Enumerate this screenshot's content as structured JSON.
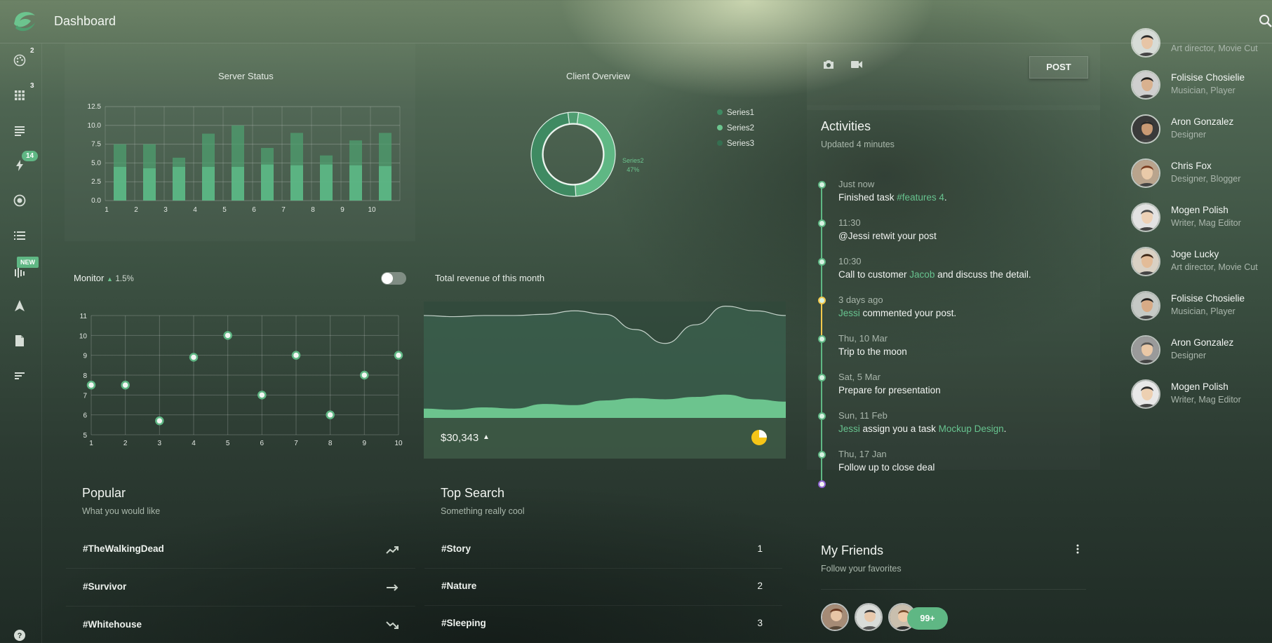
{
  "app": {
    "title": "Dashboard"
  },
  "sidebar": {
    "items": [
      {
        "icon": "palette-icon",
        "badge": "2"
      },
      {
        "icon": "apps-icon",
        "badge": "3"
      },
      {
        "icon": "notes-icon",
        "badge": ""
      },
      {
        "icon": "flash-icon",
        "badge": "14"
      },
      {
        "icon": "record-icon",
        "badge": ""
      },
      {
        "icon": "list-icon",
        "badge": ""
      },
      {
        "icon": "waveform-icon",
        "badge": "NEW"
      },
      {
        "icon": "navigation-icon",
        "badge": ""
      },
      {
        "icon": "file-icon",
        "badge": ""
      },
      {
        "icon": "sort-icon",
        "badge": ""
      },
      {
        "icon": "help-icon",
        "badge": ""
      }
    ]
  },
  "server_status": {
    "title": "Server Status"
  },
  "client_overview": {
    "title": "Client Overview",
    "legend": [
      "Series1",
      "Series2",
      "Series3"
    ],
    "tooltip_series": "Series2",
    "tooltip_value": "47%"
  },
  "monitor": {
    "title": "Monitor",
    "change": "1.5%"
  },
  "revenue": {
    "title": "Total revenue of this month",
    "amount": "$30,343"
  },
  "popular": {
    "title": "Popular",
    "subtitle": "What you would like",
    "items": [
      {
        "label": "#TheWalkingDead",
        "trend": "trending-up-icon"
      },
      {
        "label": "#Survivor",
        "trend": "trending-flat-icon"
      },
      {
        "label": "#Whitehouse",
        "trend": "trending-down-icon"
      }
    ]
  },
  "top_search": {
    "title": "Top Search",
    "subtitle": "Something really cool",
    "items": [
      {
        "label": "#Story",
        "rank": "1"
      },
      {
        "label": "#Nature",
        "rank": "2"
      },
      {
        "label": "#Sleeping",
        "rank": "3"
      }
    ]
  },
  "composer": {
    "post_label": "POST"
  },
  "activities": {
    "title": "Activities",
    "subtitle": "Updated 4 minutes",
    "items": [
      {
        "time": "Just now",
        "pre": "Finished task ",
        "link": "#features 4",
        "post": ".",
        "dot": "#5fb784"
      },
      {
        "time": "11:30",
        "pre": "@Jessi retwit your post",
        "link": "",
        "post": "",
        "dot": "#5fb784"
      },
      {
        "time": "10:30",
        "pre": "Call to customer ",
        "link": "Jacob",
        "post": " and discuss the detail.",
        "dot": "#5fb784"
      },
      {
        "time": "3 days ago",
        "pre": "",
        "link": "Jessi",
        "post": " commented your post.",
        "dot": "#f2c94c"
      },
      {
        "time": "Thu, 10 Mar",
        "pre": "Trip to the moon",
        "link": "",
        "post": "",
        "dot": "#5fb784"
      },
      {
        "time": "Sat, 5 Mar",
        "pre": "Prepare for presentation",
        "link": "",
        "post": "",
        "dot": "#5fb784"
      },
      {
        "time": "Sun, 11 Feb",
        "pre": "",
        "link": "Jessi",
        "post": " assign you a task ",
        "link2": "Mockup Design",
        "post2": ".",
        "dot": "#5fb784"
      },
      {
        "time": "Thu, 17 Jan",
        "pre": "Follow up to close deal",
        "link": "",
        "post": "",
        "dot": "#5fb784"
      }
    ]
  },
  "friends": {
    "title": "My Friends",
    "subtitle": "Follow your favorites",
    "more": "99+"
  },
  "people": [
    {
      "name": "",
      "role": "Art director, Movie Cut"
    },
    {
      "name": "Folisise Chosielie",
      "role": "Musician, Player"
    },
    {
      "name": "Aron Gonzalez",
      "role": "Designer"
    },
    {
      "name": "Chris Fox",
      "role": "Designer, Blogger"
    },
    {
      "name": "Mogen Polish",
      "role": "Writer, Mag Editor"
    },
    {
      "name": "Joge Lucky",
      "role": "Art director, Movie Cut"
    },
    {
      "name": "Folisise Chosielie",
      "role": "Musician, Player"
    },
    {
      "name": "Aron Gonzalez",
      "role": "Designer"
    },
    {
      "name": "Mogen Polish",
      "role": "Writer, Mag Editor"
    }
  ],
  "chart_data": [
    {
      "type": "bar",
      "title": "Server Status",
      "categories": [
        "1",
        "2",
        "3",
        "4",
        "5",
        "6",
        "7",
        "8",
        "9",
        "10"
      ],
      "series": [
        {
          "values": [
            4.5,
            4.3,
            4.5,
            4.5,
            4.5,
            4.8,
            4.7,
            4.8,
            4.7,
            4.6
          ]
        },
        {
          "values": [
            3.0,
            3.2,
            1.2,
            4.4,
            5.5,
            2.2,
            4.3,
            1.2,
            3.3,
            4.4
          ]
        }
      ],
      "ylim": [
        0,
        12.5
      ],
      "yticks": [
        "0.0",
        "2.5",
        "5.0",
        "7.5",
        "10.0",
        "12.5"
      ],
      "colors": [
        "#5cb785",
        "#4e9f6f"
      ],
      "grid": true
    },
    {
      "type": "pie",
      "title": "Client Overview",
      "labels": [
        "Series1",
        "Series2",
        "Series3"
      ],
      "values": [
        49,
        47,
        4
      ],
      "colors": [
        "#3f8a62",
        "#5fb784",
        "#4f9d71"
      ],
      "legend": "right"
    },
    {
      "type": "scatter",
      "title": "Monitor",
      "x": [
        1,
        2,
        3,
        4,
        5,
        6,
        7,
        8,
        9,
        10
      ],
      "y": [
        7.5,
        7.5,
        5.7,
        8.9,
        10,
        7,
        9,
        6,
        8,
        9
      ],
      "xlim": [
        1,
        10
      ],
      "ylim": [
        5,
        11
      ],
      "grid": true
    },
    {
      "type": "area",
      "title": "Total revenue of this month",
      "x": [
        0,
        1,
        2,
        3,
        4,
        5,
        6,
        7,
        8,
        9,
        10,
        11,
        12
      ],
      "series": [
        {
          "values": [
            88,
            87,
            88,
            88,
            89,
            92,
            89,
            76,
            64,
            80,
            96,
            92,
            88
          ]
        },
        {
          "values": [
            8,
            7,
            9,
            8,
            12,
            11,
            15,
            17,
            16,
            18,
            20,
            16,
            14
          ]
        }
      ],
      "colors": [
        "#3f6a56",
        "#6cc48e"
      ]
    }
  ]
}
